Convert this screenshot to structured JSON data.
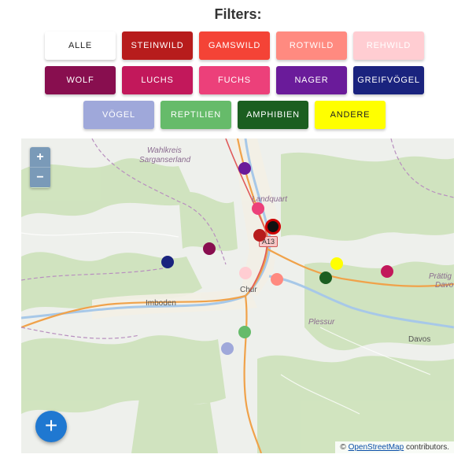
{
  "header": {
    "title": "Filters:"
  },
  "filters": [
    {
      "label": "ALLE",
      "color": "#ffffff",
      "text": "light"
    },
    {
      "label": "STEINWILD",
      "color": "#b71c1c",
      "text": "dark"
    },
    {
      "label": "GAMSWILD",
      "color": "#f44336",
      "text": "dark"
    },
    {
      "label": "ROTWILD",
      "color": "#ff8a80",
      "text": "dark"
    },
    {
      "label": "REHWILD",
      "color": "#ffcdd2",
      "text": "dark"
    },
    {
      "label": "WOLF",
      "color": "#880e4f",
      "text": "dark"
    },
    {
      "label": "LUCHS",
      "color": "#c2185b",
      "text": "dark"
    },
    {
      "label": "FUCHS",
      "color": "#ec407a",
      "text": "dark"
    },
    {
      "label": "NAGER",
      "color": "#6a1b9a",
      "text": "dark"
    },
    {
      "label": "GREIFVÖGEL",
      "color": "#1a237e",
      "text": "dark"
    },
    {
      "label": "VÖGEL",
      "color": "#9fa8da",
      "text": "dark"
    },
    {
      "label": "REPTILIEN",
      "color": "#66bb6a",
      "text": "dark"
    },
    {
      "label": "AMPHIBIEN",
      "color": "#1b5e20",
      "text": "dark"
    },
    {
      "label": "ANDERE",
      "color": "#ffff00",
      "text": "light"
    }
  ],
  "map": {
    "zoom_in": "+",
    "zoom_out": "−",
    "labels": {
      "wahlkreis": "Wahlkreis",
      "sarganserland": "Sarganserland",
      "landquart": "Landquart",
      "chur": "Chur",
      "imboden": "Imboden",
      "plessur": "Plessur",
      "davos": "Davos",
      "prattigau": "Prättig",
      "davo": "Davo",
      "road_shield": "A13"
    },
    "attribution_prefix": "©",
    "attribution_link": "OpenStreetMap",
    "attribution_suffix": "contributors.",
    "markers": [
      {
        "category": "NAGER",
        "color": "#6a1b9a"
      },
      {
        "category": "FUCHS",
        "color": "#ec407a"
      },
      {
        "category": "selected",
        "color": "#111111"
      },
      {
        "category": "STEINWILD",
        "color": "#b71c1c"
      },
      {
        "category": "WOLF",
        "color": "#880e4f"
      },
      {
        "category": "GREIFVÖGEL",
        "color": "#1a237e"
      },
      {
        "category": "REHWILD",
        "color": "#ffcdd2"
      },
      {
        "category": "ROTWILD",
        "color": "#ff8a80"
      },
      {
        "category": "ANDERE",
        "color": "#ffff00"
      },
      {
        "category": "AMPHIBIEN",
        "color": "#1b5e20"
      },
      {
        "category": "LUCHS",
        "color": "#c2185b"
      },
      {
        "category": "REPTILIEN",
        "color": "#66bb6a"
      },
      {
        "category": "VÖGEL",
        "color": "#9fa8da"
      }
    ]
  },
  "fab": {
    "label": "+"
  }
}
